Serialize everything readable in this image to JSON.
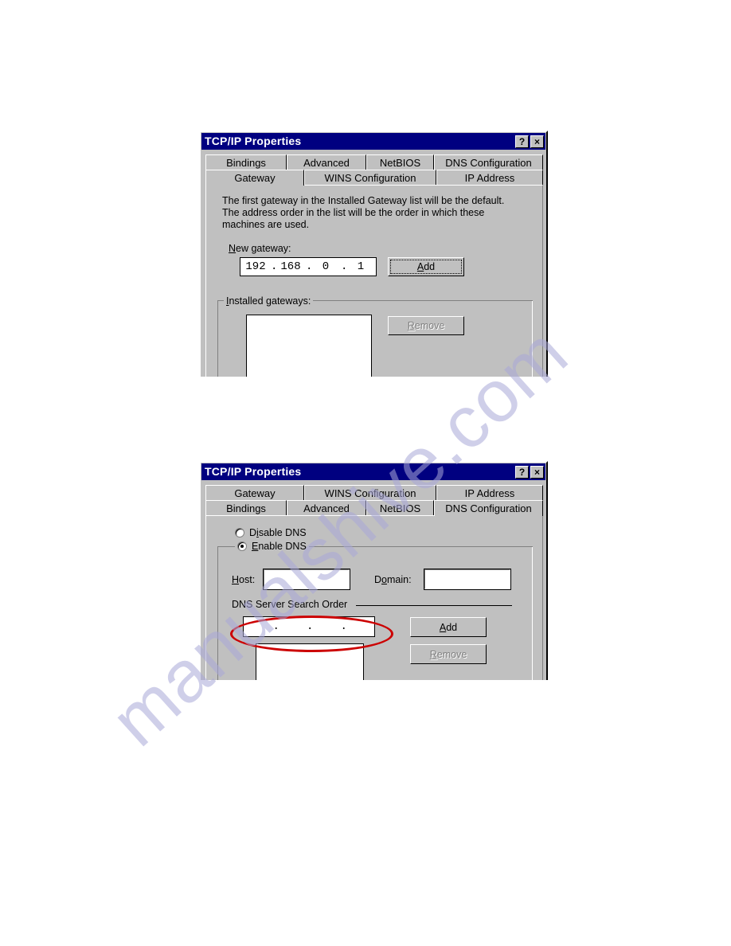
{
  "watermark": {
    "text": "manualshive.com"
  },
  "colors": {
    "titlebar": "#000080",
    "dialog_face": "#c0c0c0",
    "annotation": "#cc0000",
    "watermark": "#a9a8d8"
  },
  "dialog_gateway": {
    "title": "TCP/IP Properties",
    "titlebar_buttons": [
      {
        "name": "help",
        "glyph": "?"
      },
      {
        "name": "close",
        "glyph": "×"
      }
    ],
    "tabs_back_row": [
      "Bindings",
      "Advanced",
      "NetBIOS",
      "DNS Configuration"
    ],
    "tabs_front_row": [
      "Gateway",
      "WINS Configuration",
      "IP Address"
    ],
    "active_tab": "Gateway",
    "description": "The first gateway in the Installed Gateway list will be the default. The address order in the list will be the order in which these machines are used.",
    "new_gateway_label": "New gateway:",
    "new_gateway_label_accel": "N",
    "new_gateway_label_rest": "ew gateway:",
    "new_gateway_ip": {
      "octets": [
        "192",
        "168",
        "0",
        "1"
      ],
      "separator": "."
    },
    "add_button": {
      "label": "Add",
      "accel": "A",
      "rest": "dd",
      "enabled": true,
      "focused": true
    },
    "installed_group_label": "Installed gateways:",
    "installed_group_accel": "I",
    "installed_group_rest": "nstalled gateways:",
    "installed_list_items": [],
    "remove_button": {
      "label": "Remove",
      "accel": "R",
      "rest": "emove",
      "enabled": false
    }
  },
  "dialog_dns": {
    "title": "TCP/IP Properties",
    "titlebar_buttons": [
      {
        "name": "help",
        "glyph": "?"
      },
      {
        "name": "close",
        "glyph": "×"
      }
    ],
    "tabs_back_row": [
      "Gateway",
      "WINS Configuration",
      "IP Address"
    ],
    "tabs_front_row": [
      "Bindings",
      "Advanced",
      "NetBIOS",
      "DNS Configuration"
    ],
    "active_tab": "DNS Configuration",
    "radio_disable": {
      "label": "Disable DNS",
      "accel": "i",
      "pre": "D",
      "rest": "sable DNS",
      "selected": false
    },
    "radio_enable": {
      "label": "Enable DNS",
      "accel": "E",
      "rest": "nable DNS",
      "selected": true
    },
    "host_label": "Host:",
    "host_label_accel": "H",
    "host_label_rest": "ost:",
    "host_value": "",
    "domain_label": "Domain:",
    "domain_label_pre": "D",
    "domain_label_accel": "o",
    "domain_label_rest": "main:",
    "search_order_group_label": "DNS Server Search Order",
    "dns_ip": {
      "octets": [
        "",
        "",
        "",
        ""
      ],
      "separator": "."
    },
    "add_button": {
      "label": "Add",
      "accel": "A",
      "rest": "dd",
      "enabled": true
    },
    "remove_button": {
      "label": "Remove",
      "accel": "R",
      "rest": "emove",
      "enabled": false
    },
    "server_list_items": [],
    "annotation": {
      "type": "ellipse",
      "color": "#cc0000",
      "target": "dns-server-ip-input"
    }
  }
}
